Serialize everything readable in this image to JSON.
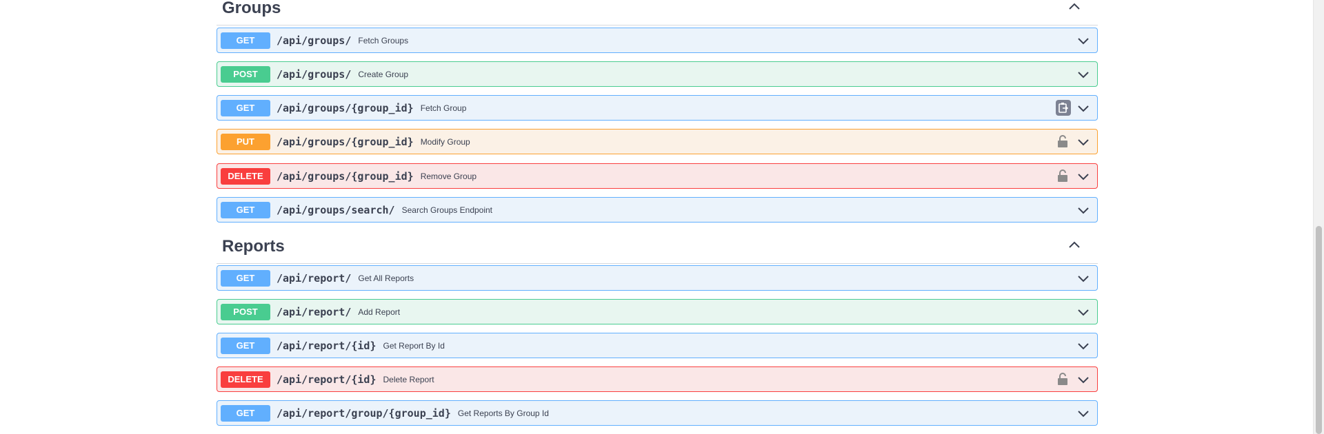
{
  "sections": [
    {
      "title": "Groups",
      "operations": [
        {
          "method": "GET",
          "path": "/api/groups/",
          "summary": "Fetch Groups"
        },
        {
          "method": "POST",
          "path": "/api/groups/",
          "summary": "Create Group"
        },
        {
          "method": "GET",
          "path": "/api/groups/{group_id}",
          "summary": "Fetch Group"
        },
        {
          "method": "PUT",
          "path": "/api/groups/{group_id}",
          "summary": "Modify Group"
        },
        {
          "method": "DELETE",
          "path": "/api/groups/{group_id}",
          "summary": "Remove Group"
        },
        {
          "method": "GET",
          "path": "/api/groups/search/",
          "summary": "Search Groups Endpoint"
        }
      ]
    },
    {
      "title": "Reports",
      "operations": [
        {
          "method": "GET",
          "path": "/api/report/",
          "summary": "Get All Reports"
        },
        {
          "method": "POST",
          "path": "/api/report/",
          "summary": "Add Report"
        },
        {
          "method": "GET",
          "path": "/api/report/{id}",
          "summary": "Get Report By Id"
        },
        {
          "method": "DELETE",
          "path": "/api/report/{id}",
          "summary": "Delete Report"
        },
        {
          "method": "GET",
          "path": "/api/report/group/{group_id}",
          "summary": "Get Reports By Group Id"
        }
      ]
    }
  ],
  "colors": {
    "get": "#61affe",
    "post": "#49cc90",
    "put": "#fca130",
    "delete": "#f93e3e",
    "text": "#3b4151"
  }
}
